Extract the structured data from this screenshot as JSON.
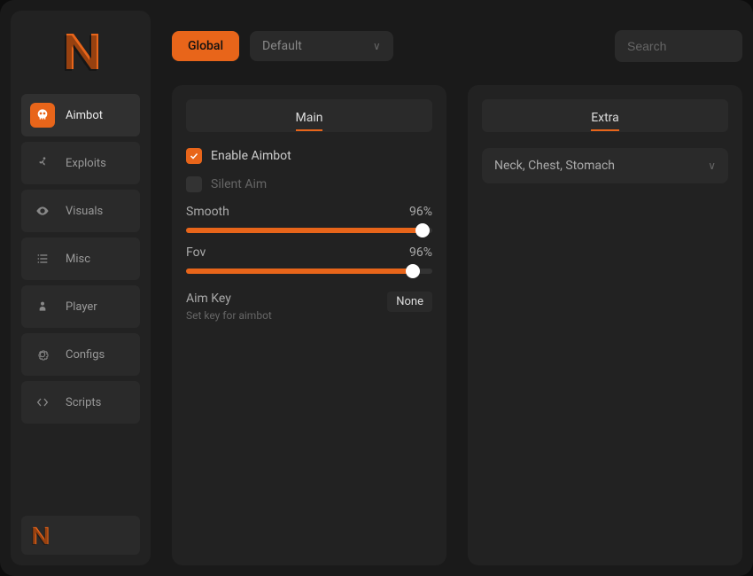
{
  "colors": {
    "accent": "#e8651a",
    "bg": "#1a1a1a",
    "panel": "#222222",
    "control": "#2a2a2a"
  },
  "sidebar": {
    "items": [
      {
        "name": "aimbot",
        "label": "Aimbot",
        "icon": "skull-icon",
        "active": true
      },
      {
        "name": "exploits",
        "label": "Exploits",
        "icon": "running-icon",
        "active": false
      },
      {
        "name": "visuals",
        "label": "Visuals",
        "icon": "eye-icon",
        "active": false
      },
      {
        "name": "misc",
        "label": "Misc",
        "icon": "list-icon",
        "active": false
      },
      {
        "name": "player",
        "label": "Player",
        "icon": "user-icon",
        "active": false
      },
      {
        "name": "configs",
        "label": "Configs",
        "icon": "gear-icon",
        "active": false
      },
      {
        "name": "scripts",
        "label": "Scripts",
        "icon": "code-icon",
        "active": false
      }
    ]
  },
  "topbar": {
    "global_label": "Global",
    "config_dropdown": {
      "selected": "Default"
    },
    "search_placeholder": "Search"
  },
  "panels": {
    "main": {
      "title": "Main",
      "enable_aimbot": {
        "label": "Enable Aimbot",
        "checked": true
      },
      "silent_aim": {
        "label": "Silent Aim",
        "checked": false
      },
      "smooth": {
        "label": "Smooth",
        "value": 96,
        "display": "96%"
      },
      "fov": {
        "label": "Fov",
        "value": 96,
        "display": "96%"
      },
      "aim_key": {
        "label": "Aim Key",
        "sublabel": "Set key for aimbot",
        "value": "None"
      }
    },
    "extra": {
      "title": "Extra",
      "bones_select": {
        "selected": "Neck, Chest, Stomach"
      }
    }
  }
}
